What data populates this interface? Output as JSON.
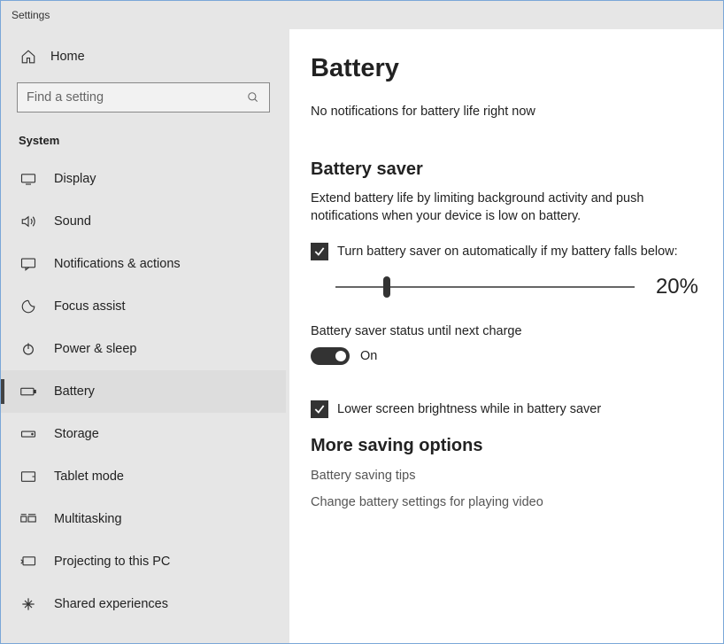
{
  "titlebar": "Settings",
  "home": {
    "label": "Home"
  },
  "search": {
    "placeholder": "Find a setting"
  },
  "category": "System",
  "nav": [
    {
      "id": "display",
      "label": "Display"
    },
    {
      "id": "sound",
      "label": "Sound"
    },
    {
      "id": "notifications",
      "label": "Notifications & actions"
    },
    {
      "id": "focus",
      "label": "Focus assist"
    },
    {
      "id": "power",
      "label": "Power & sleep"
    },
    {
      "id": "battery",
      "label": "Battery",
      "selected": true
    },
    {
      "id": "storage",
      "label": "Storage"
    },
    {
      "id": "tablet",
      "label": "Tablet mode"
    },
    {
      "id": "multitasking",
      "label": "Multitasking"
    },
    {
      "id": "projecting",
      "label": "Projecting to this PC"
    },
    {
      "id": "shared",
      "label": "Shared experiences"
    }
  ],
  "page": {
    "title": "Battery",
    "notification": "No notifications for battery life right now",
    "saver": {
      "heading": "Battery saver",
      "description": "Extend battery life by limiting background activity and push notifications when your device is low on battery.",
      "auto_checkbox": {
        "label": "Turn battery saver on automatically if my battery falls below:",
        "checked": true
      },
      "threshold": {
        "value": 20,
        "display": "20%"
      },
      "status_label": "Battery saver status until next charge",
      "status_toggle": {
        "on": true,
        "label": "On"
      },
      "brightness_checkbox": {
        "label": "Lower screen brightness while in battery saver",
        "checked": true
      }
    },
    "more": {
      "heading": "More saving options",
      "links": [
        "Battery saving tips",
        "Change battery settings for playing video"
      ]
    }
  }
}
